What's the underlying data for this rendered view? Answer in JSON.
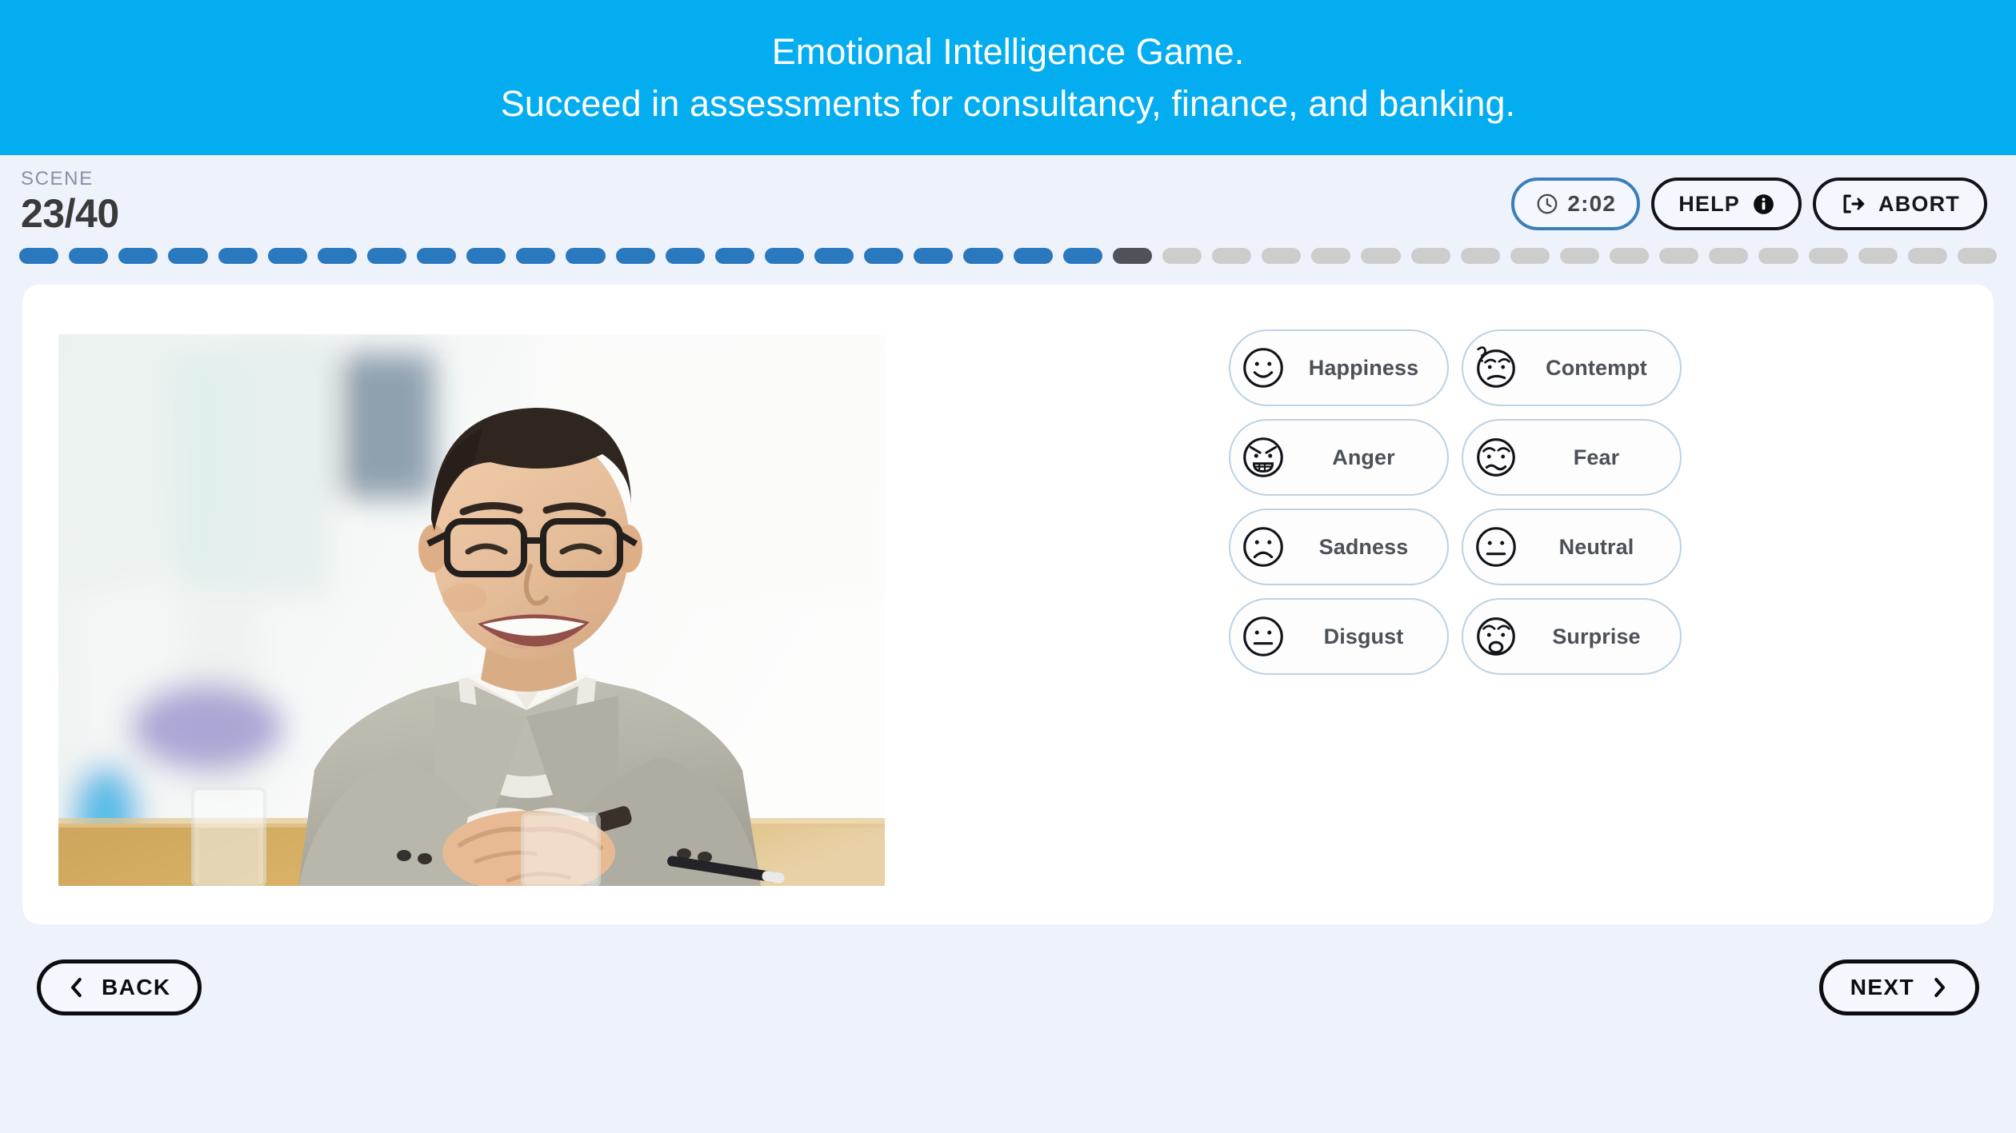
{
  "banner": {
    "line1": "Emotional Intelligence Game.",
    "line2": "Succeed in assessments for consultancy, finance, and banking.",
    "background_color": "#03adef",
    "text_color": "#ffffff"
  },
  "scene": {
    "label": "SCENE",
    "value": "23/40",
    "current": 23,
    "total": 40
  },
  "top_actions": {
    "timer": {
      "label": "2:02",
      "icon": "clock-icon",
      "border_color": "#3c7fb8"
    },
    "help": {
      "label": "HELP",
      "icon": "info-icon"
    },
    "abort": {
      "label": "ABORT",
      "icon": "exit-icon"
    }
  },
  "progress": {
    "done_color": "#2a78bd",
    "current_color": "#4f5257",
    "todo_color": "#cdcdcd",
    "done_count": 22,
    "current_index": 23,
    "total": 40
  },
  "photo": {
    "alt": "Smiling man in grey blazer and glasses seated at a wooden desk with hands clasped",
    "accent_colors": {
      "blazer": "#b3b0a5",
      "skin": "#e8bd97",
      "hair": "#241a14",
      "desk": "#c8913f",
      "background": "#f2f5f4",
      "blue_cup": "#3fb4e5",
      "purple_object": "#8f86c8"
    }
  },
  "emotions": [
    {
      "label": "Happiness",
      "icon": "face-happy-icon"
    },
    {
      "label": "Contempt",
      "icon": "face-contempt-icon"
    },
    {
      "label": "Anger",
      "icon": "face-anger-icon"
    },
    {
      "label": "Fear",
      "icon": "face-fear-icon"
    },
    {
      "label": "Sadness",
      "icon": "face-sad-icon"
    },
    {
      "label": "Neutral",
      "icon": "face-neutral-icon"
    },
    {
      "label": "Disgust",
      "icon": "face-disgust-icon"
    },
    {
      "label": "Surprise",
      "icon": "face-surprise-icon"
    }
  ],
  "footer": {
    "back": {
      "label": "BACK",
      "icon": "chevron-left-icon"
    },
    "next": {
      "label": "NEXT",
      "icon": "chevron-right-icon"
    }
  },
  "theme": {
    "page_background": "#eef3fb",
    "card_background": "#ffffff",
    "button_border": "#bcd2e3",
    "text_primary": "#3a3a3a",
    "text_muted": "#8791a3"
  }
}
